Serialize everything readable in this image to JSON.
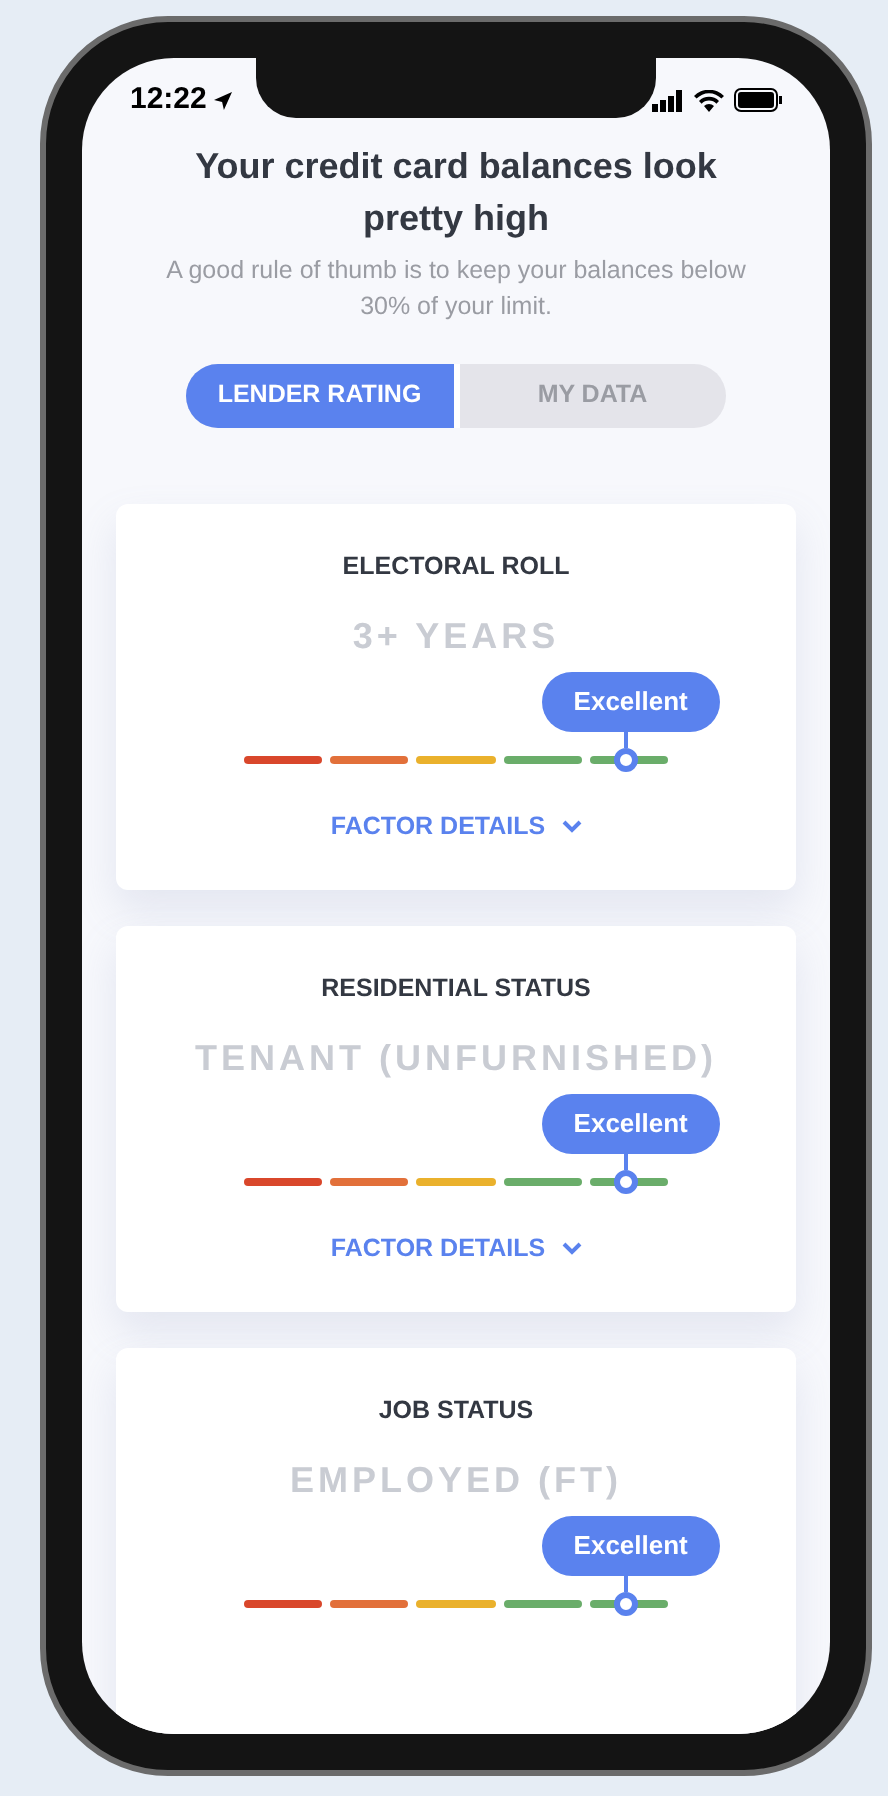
{
  "status_bar": {
    "time": "12:22"
  },
  "header": {
    "title": "Your credit card balances look pretty high",
    "subtitle": "A good rule of thumb is to keep your balances below 30% of your limit."
  },
  "tabs": [
    {
      "label": "LENDER RATING",
      "selected": true
    },
    {
      "label": "MY DATA",
      "selected": false
    }
  ],
  "factors": [
    {
      "name": "ELECTORAL ROLL",
      "value": "3+ YEARS",
      "rating": "Excellent",
      "level": 0.9,
      "details_link": "FACTOR DETAILS"
    },
    {
      "name": "RESIDENTIAL STATUS",
      "value": "TENANT (UNFURNISHED)",
      "rating": "Excellent",
      "level": 0.9,
      "details_link": "FACTOR DETAILS"
    },
    {
      "name": "JOB STATUS",
      "value": "EMPLOYED (FT)",
      "rating": "Excellent",
      "level": 0.9
    }
  ]
}
